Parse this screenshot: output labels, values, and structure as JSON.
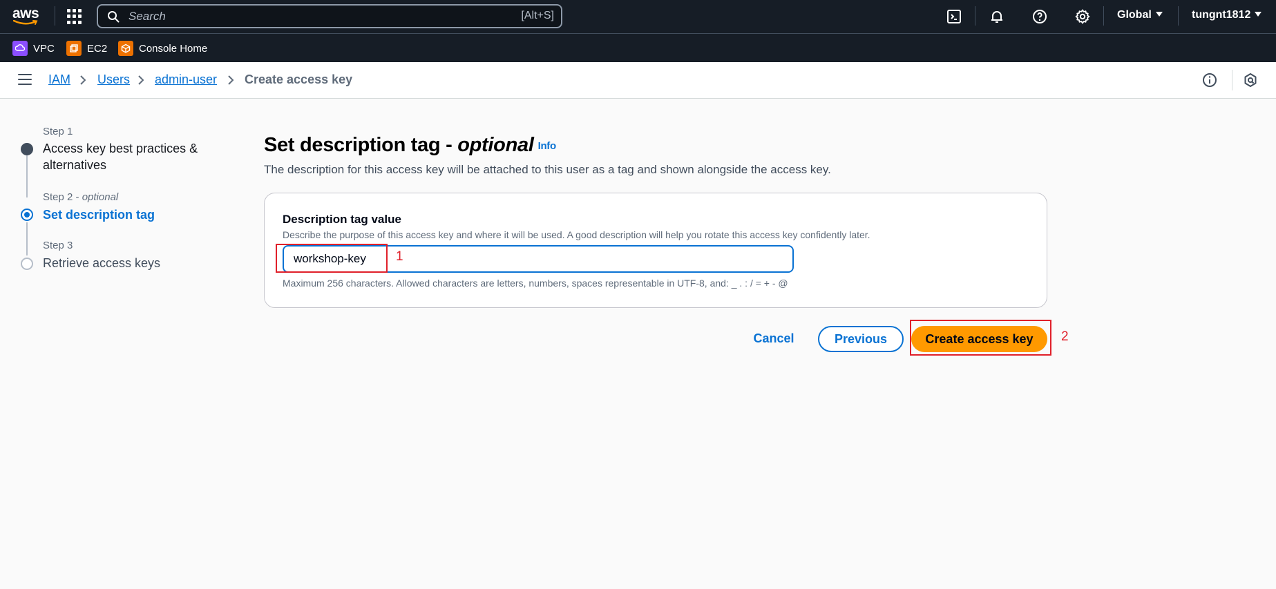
{
  "topnav": {
    "logo": "aws",
    "search_placeholder": "Search",
    "search_shortcut": "[Alt+S]",
    "region": "Global",
    "user": "tungnt1812",
    "icons": [
      "cloudshell-icon",
      "bell-icon",
      "help-icon",
      "gear-icon"
    ]
  },
  "favorites": [
    {
      "label": "VPC",
      "icon": "vpc-icon",
      "color": "#8c4fff"
    },
    {
      "label": "EC2",
      "icon": "ec2-icon",
      "color": "#ed7100"
    },
    {
      "label": "Console Home",
      "icon": "console-home-icon",
      "color": "#ed7100"
    }
  ],
  "breadcrumb": {
    "items": [
      "IAM",
      "Users",
      "admin-user"
    ],
    "current": "Create access key"
  },
  "steps": [
    {
      "label": "Step 1",
      "title_line1": "Access key best practices &",
      "title_line2": "alternatives",
      "state": "completed"
    },
    {
      "label": "Step 2 - ",
      "label_optional": "optional",
      "title": "Set description tag",
      "state": "active"
    },
    {
      "label": "Step 3",
      "title": "Retrieve access keys",
      "state": "pending"
    }
  ],
  "main": {
    "title": "Set description tag - ",
    "title_optional": "optional",
    "info": "Info",
    "subtitle": "The description for this access key will be attached to this user as a tag and shown alongside the access key."
  },
  "form": {
    "label": "Description tag value",
    "description": "Describe the purpose of this access key and where it will be used. A good description will help you rotate this access key confidently later.",
    "value": "workshop-key",
    "constraint": "Maximum 256 characters. Allowed characters are letters, numbers, spaces representable in UTF-8, and: _ . : / = + - @"
  },
  "actions": {
    "cancel": "Cancel",
    "previous": "Previous",
    "create": "Create access key"
  },
  "annotations": [
    "1",
    "2"
  ],
  "colors": {
    "nav_bg": "#161d26",
    "link": "#0972d3",
    "primary_button": "#ff9900",
    "annotation": "#e0202a"
  }
}
